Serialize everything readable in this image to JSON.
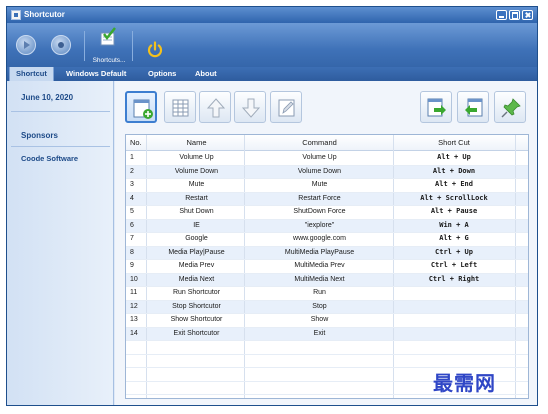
{
  "window": {
    "title": "Shortcutor"
  },
  "toolbar": {
    "shortcuts_label": "Shortcuts..."
  },
  "tabs": [
    {
      "label": "Shortcut",
      "active": true
    },
    {
      "label": "Windows Default",
      "active": false
    },
    {
      "label": "Options",
      "active": false
    },
    {
      "label": "About",
      "active": false
    }
  ],
  "sidebar": {
    "date": "June 10, 2020",
    "sponsors_heading": "Sponsors",
    "sponsor_link": "Coode Software"
  },
  "table": {
    "columns": [
      "No.",
      "Name",
      "Command",
      "Short Cut"
    ],
    "rows": [
      [
        "1",
        "Volume Up",
        "Volume Up",
        "Alt + Up"
      ],
      [
        "2",
        "Volume Down",
        "Volume Down",
        "Alt + Down"
      ],
      [
        "3",
        "Mute",
        "Mute",
        "Alt + End"
      ],
      [
        "4",
        "Restart",
        "Restart Force",
        "Alt + ScrollLock"
      ],
      [
        "5",
        "Shut Down",
        "ShutDown Force",
        "Alt + Pause"
      ],
      [
        "6",
        "IE",
        "\"iexplore\"",
        "Win + A"
      ],
      [
        "7",
        "Google",
        "www.google.com",
        "Alt + G"
      ],
      [
        "8",
        "Media Play|Pause",
        "MultiMedia PlayPause",
        "Ctrl + Up"
      ],
      [
        "9",
        "Media Prev",
        "MultiMedia Prev",
        "Ctrl + Left"
      ],
      [
        "10",
        "Media Next",
        "MultiMedia Next",
        "Ctrl + Right"
      ],
      [
        "11",
        "Run Shortcutor",
        "Run",
        ""
      ],
      [
        "12",
        "Stop Shortcutor",
        "Stop",
        ""
      ],
      [
        "13",
        "Show Shortcutor",
        "Show",
        ""
      ],
      [
        "14",
        "Exit Shortcutor",
        "Exit",
        ""
      ]
    ]
  },
  "watermark": "最需网",
  "colors": {
    "titlebar": "#2f64ad",
    "accent": "#1d4a88",
    "row_alt": "#e8f0fb"
  }
}
